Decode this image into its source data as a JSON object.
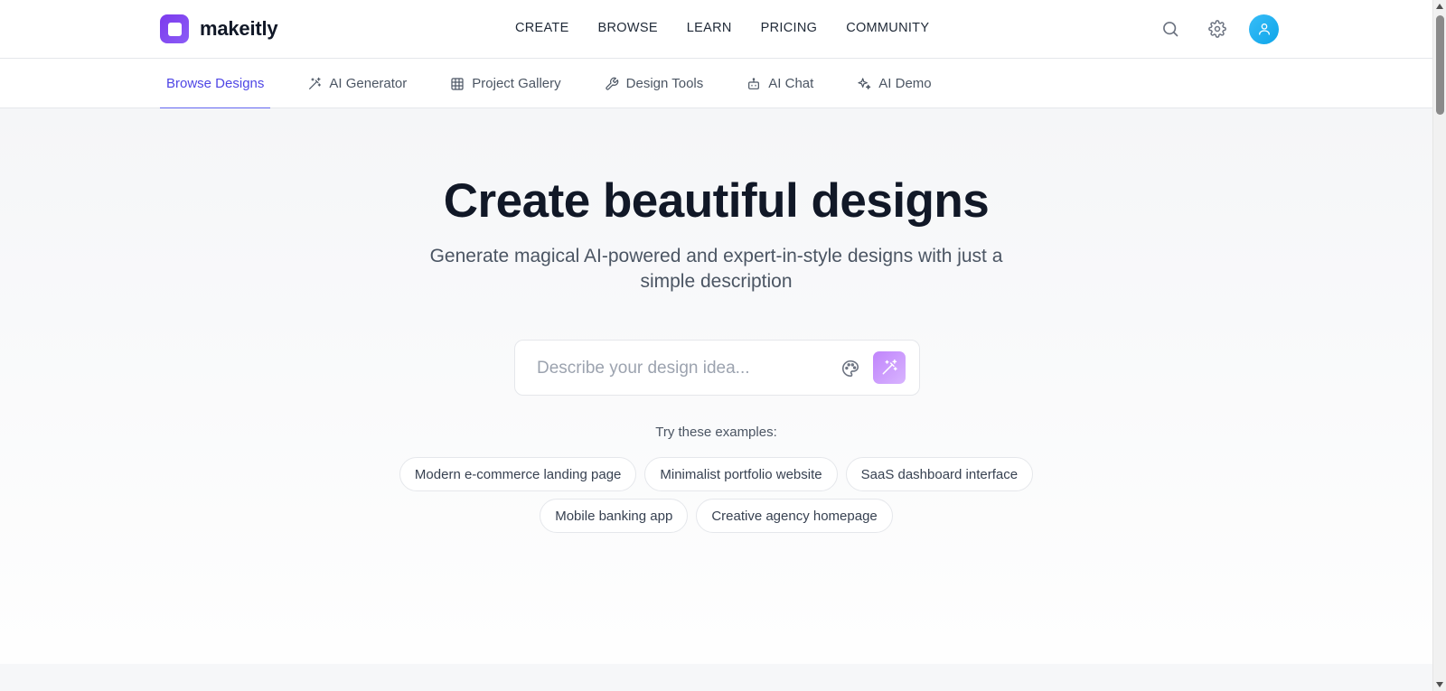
{
  "app": {
    "name": "makeitly"
  },
  "main_nav": {
    "items": [
      "CREATE",
      "BROWSE",
      "LEARN",
      "PRICING",
      "COMMUNITY"
    ]
  },
  "top_actions": {
    "icons": [
      "search-icon",
      "gear-icon",
      "user-icon"
    ]
  },
  "sub_nav": {
    "items": [
      {
        "label": "Browse Designs",
        "icon": "",
        "active": true
      },
      {
        "label": "AI Generator",
        "icon": "magic-wand-icon",
        "active": false
      },
      {
        "label": "Project Gallery",
        "icon": "grid-icon",
        "active": false
      },
      {
        "label": "Design Tools",
        "icon": "wrench-icon",
        "active": false
      },
      {
        "label": "AI Chat",
        "icon": "bot-icon",
        "active": false
      },
      {
        "label": "AI Demo",
        "icon": "sparkles-icon",
        "active": false
      }
    ]
  },
  "hero": {
    "title": "Create beautiful designs",
    "subtitle": "Generate magical AI-powered and expert-in-style designs with just a simple description",
    "search": {
      "value": "",
      "placeholder": "Describe your design idea..."
    },
    "examples_label": "Try these examples:",
    "examples": [
      "Modern e-commerce landing page",
      "Minimalist portfolio website",
      "SaaS dashboard interface",
      "Mobile banking app",
      "Creative agency homepage"
    ]
  },
  "colors": {
    "brand": "#7c3aed",
    "accent": "#6366f1",
    "avatar": "#0ea5e9",
    "magic_button": "#c084fc"
  }
}
